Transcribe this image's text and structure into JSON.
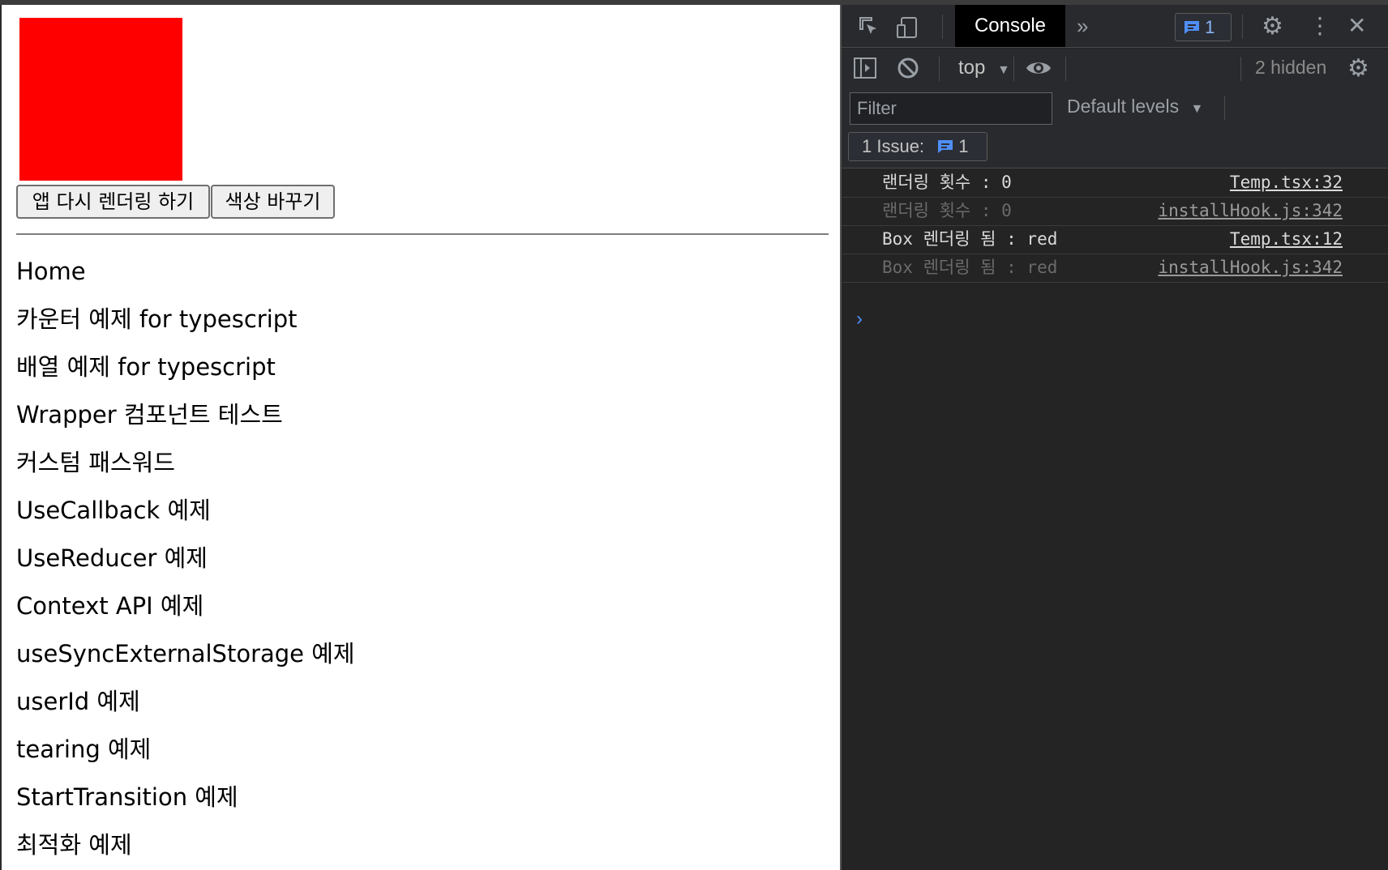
{
  "app": {
    "box_color": "#ff0000",
    "buttons": {
      "rerender_label": "앱 다시 렌더링 하기",
      "change_color_label": "색상 바꾸기"
    },
    "nav_items": [
      "Home",
      "카운터 예제 for typescript",
      "배열 예제 for typescript",
      "Wrapper 컴포넌트 테스트",
      "커스텀 패스워드",
      "UseCallback 예제",
      "UseReducer 예제",
      "Context API 예제",
      "useSyncExternalStorage 예제",
      "userId 예제",
      "tearing 예제",
      "StartTransition 예제",
      "최적화 예제"
    ]
  },
  "devtools": {
    "active_tab": "Console",
    "issue_badge_count": "1",
    "context": "top",
    "hidden_count": "2 hidden",
    "filter_placeholder": "Filter",
    "levels": "Default levels",
    "issues_label": "1 Issue:",
    "issues_count": "1",
    "logs": [
      {
        "message": "랜더링 횟수 : 0",
        "source": "Temp.tsx:32",
        "faded": false
      },
      {
        "message": "랜더링 횟수 : 0",
        "source": "installHook.js:342",
        "faded": true
      },
      {
        "message": "Box 렌더링 됨 : red",
        "source": "Temp.tsx:12",
        "faded": false
      },
      {
        "message": "Box 렌더링 됨 : red",
        "source": "installHook.js:342",
        "faded": true
      }
    ],
    "icons": {
      "inspect": "inspect-element-icon",
      "device": "device-toolbar-icon",
      "more_tabs": "chevron-double-right-icon",
      "issues": "message-icon",
      "settings": "gear-icon",
      "menu": "kebab-menu-icon",
      "close": "close-icon",
      "sidebar": "sidebar-toggle-icon",
      "clear": "clear-console-icon",
      "eye": "eye-icon",
      "prompt": "chevron-right-icon"
    }
  }
}
